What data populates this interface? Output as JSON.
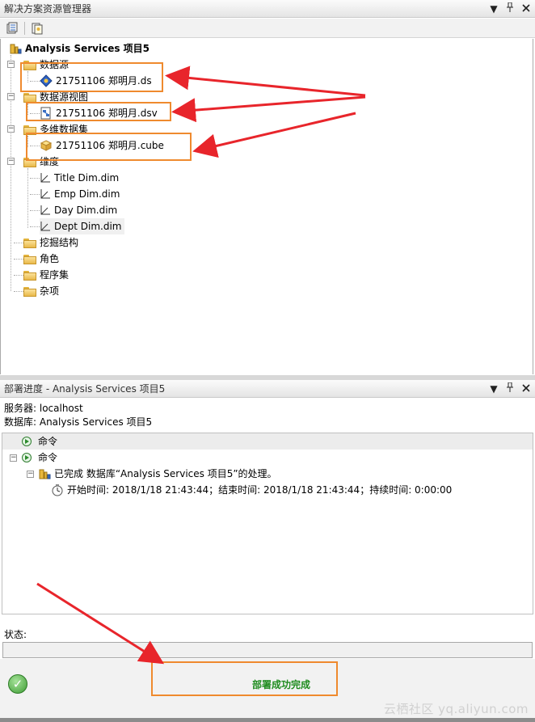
{
  "solution_explorer": {
    "title": "解决方案资源管理器",
    "controls": {
      "dropdown": "▼",
      "pin": "📌",
      "close": "✕"
    },
    "project": "Analysis Services 项目5",
    "nodes": [
      {
        "label": "数据源",
        "children": [
          "21751106 郑明月.ds"
        ]
      },
      {
        "label": "数据源视图",
        "children": [
          "21751106 郑明月.dsv"
        ]
      },
      {
        "label": "多维数据集",
        "children": [
          "21751106 郑明月.cube"
        ]
      },
      {
        "label": "维度",
        "children": [
          "Title Dim.dim",
          "Emp Dim.dim",
          "Day Dim.dim",
          "Dept Dim.dim"
        ]
      },
      {
        "label": "挖掘结构",
        "children": []
      },
      {
        "label": "角色",
        "children": []
      },
      {
        "label": "程序集",
        "children": []
      },
      {
        "label": "杂项",
        "children": []
      }
    ]
  },
  "deploy_panel": {
    "title": "部署进度 - Analysis Services 项目5",
    "server_line": "服务器: localhost",
    "database_line": "数据库: Analysis Services 项目5",
    "log": {
      "cmd1": "命令",
      "cmd2": "命令",
      "done": "已完成 数据库“Analysis Services 项目5”的处理。",
      "timing": "开始时间: 2018/1/18 21:43:44；结束时间: 2018/1/18 21:43:44；持续时间: 0:00:00"
    },
    "status_label": "状态:",
    "success_text": "部署成功完成"
  },
  "watermark": "云栖社区 yq.aliyun.com",
  "accent": {
    "highlight": "#ef8a2e",
    "arrow": "#e8252b",
    "success": "#1f8c1f"
  }
}
